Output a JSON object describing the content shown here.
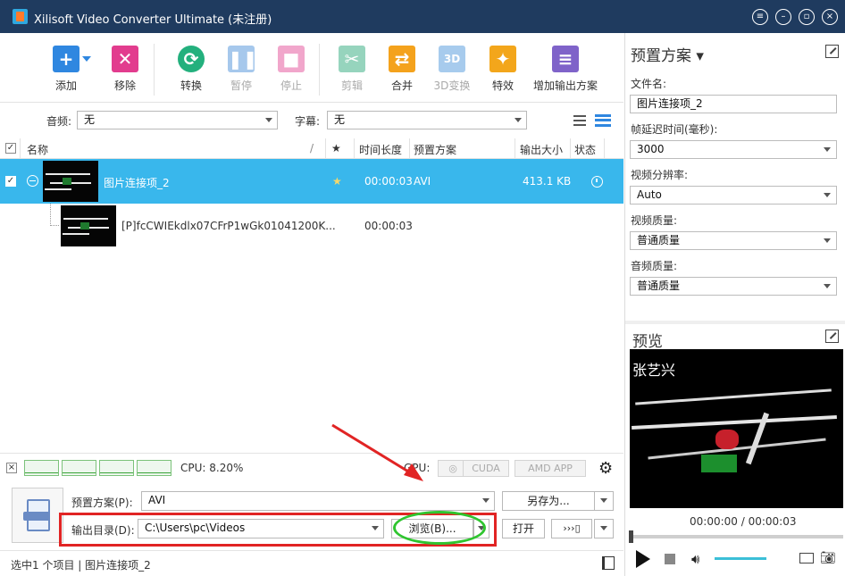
{
  "window": {
    "title": "Xilisoft Video Converter Ultimate (未注册)"
  },
  "toolbar": {
    "add": "添加",
    "remove": "移除",
    "convert": "转换",
    "pause": "暂停",
    "stop": "停止",
    "clip": "剪辑",
    "merge": "合并",
    "three_d": "3D变换",
    "effects": "特效",
    "add_profile": "增加输出方案"
  },
  "filters": {
    "audio_label": "音频:",
    "audio_value": "无",
    "subtitle_label": "字幕:",
    "subtitle_value": "无"
  },
  "columns": {
    "name": "名称",
    "duration": "时间长度",
    "profile": "预置方案",
    "size": "输出大小",
    "status": "状态"
  },
  "rows": [
    {
      "name": "图片连接项_2",
      "duration": "00:00:03",
      "profile": "AVI",
      "size": "413.1 KB"
    },
    {
      "name": "[P]fcCWIEkdlx07CFrP1wGk01041200K...",
      "duration": "00:00:03"
    }
  ],
  "status": {
    "cpu": "CPU: 8.20%",
    "gpu": "GPU:",
    "cuda": "CUDA",
    "amd": "AMD APP"
  },
  "output": {
    "profile_label": "预置方案(P):",
    "profile_value": "AVI",
    "save_as": "另存为...",
    "dir_label": "输出目录(D):",
    "dir_value": "C:\\Users\\pc\\Videos",
    "browse": "浏览(B)...",
    "open": "打开"
  },
  "footer": {
    "text": "选中1 个项目 | 图片连接项_2"
  },
  "right": {
    "panel_title": "预置方案",
    "filename_label": "文件名:",
    "filename_value": "图片连接项_2",
    "delay_label": "帧延迟时间(毫秒):",
    "delay_value": "3000",
    "resolution_label": "视频分辨率:",
    "resolution_value": "Auto",
    "vquality_label": "视频质量:",
    "vquality_value": "普通质量",
    "aquality_label": "音频质量:",
    "aquality_value": "普通质量",
    "preview_title": "预览",
    "preview_caption": "张艺兴",
    "time": "00:00:00 / 00:00:03"
  },
  "colors": {
    "titlebar": "#1f3b5f",
    "selected_row": "#39b7ec",
    "highlight_box": "#e12424",
    "highlight_ellipse": "#2fc52f",
    "arrow": "#e12424"
  }
}
